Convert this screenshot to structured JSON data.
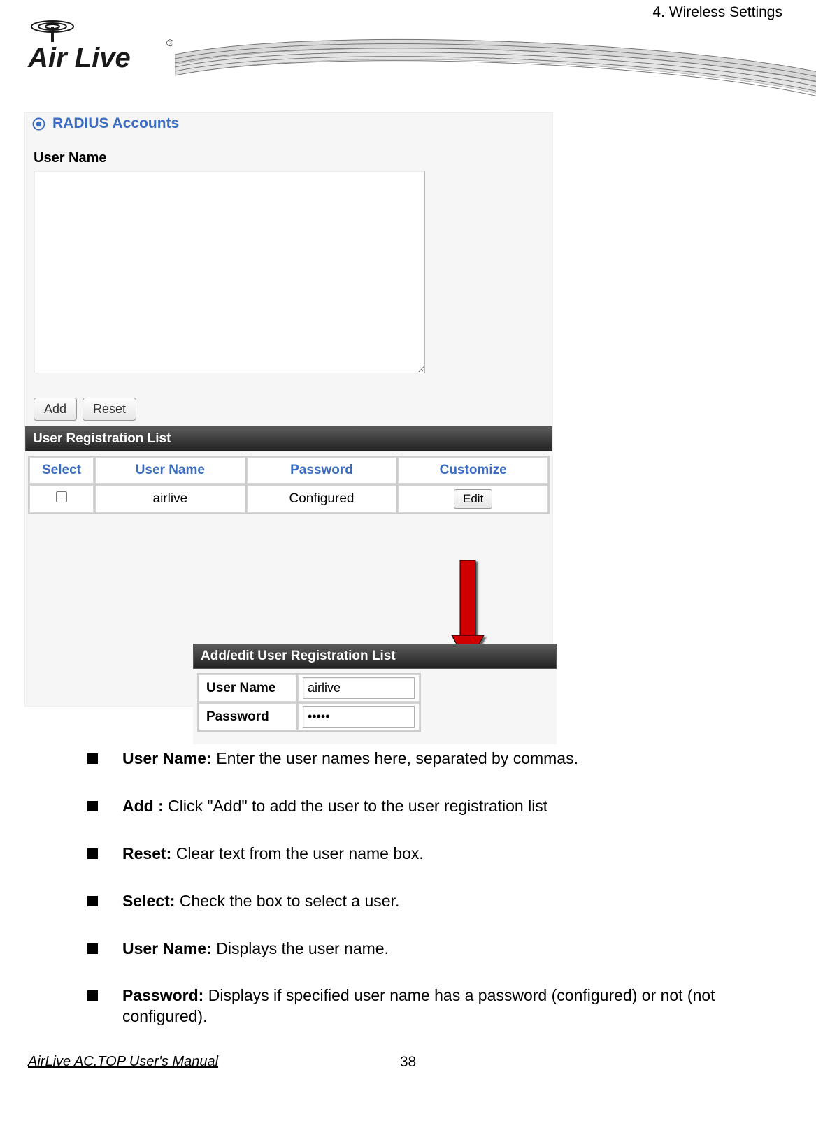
{
  "header": {
    "chapter": "4. Wireless Settings",
    "logo_text": "Air Live"
  },
  "radius": {
    "title": "RADIUS Accounts",
    "username_label": "User Name",
    "textarea_value": "",
    "add_btn": "Add",
    "reset_btn": "Reset"
  },
  "reglist": {
    "bar": "User Registration List",
    "headers": {
      "select": "Select",
      "username": "User Name",
      "password": "Password",
      "customize": "Customize"
    },
    "row": {
      "username": "airlive",
      "password": "Configured",
      "edit_btn": "Edit"
    }
  },
  "editpanel": {
    "bar": "Add/edit User Registration List",
    "username_label": "User Name",
    "username_value": "airlive",
    "password_label": "Password",
    "password_value": "•••••"
  },
  "notes": {
    "i0b": "User Name:",
    "i0t": " Enter the user names here, separated by commas.",
    "i1b": "Add :",
    "i1t": " Click \"Add\" to add the user to the user registration list",
    "i2b": "Reset:",
    "i2t": " Clear text from the user name box.",
    "i3b": "Select:",
    "i3t": " Check the box to select a user.",
    "i4b": "User Name:",
    "i4t": " Displays the user name.",
    "i5b": "Password:",
    "i5t": " Displays if specified user name has a password (configured) or not (not configured)."
  },
  "footer": {
    "left": "AirLive AC.TOP User's Manual",
    "page": "38"
  }
}
